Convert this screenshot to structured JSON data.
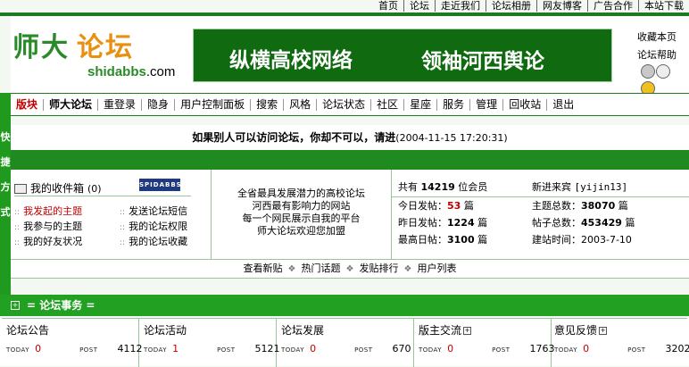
{
  "top_nav": [
    "首页",
    "论坛",
    "走近我们",
    "论坛相册",
    "网友博客",
    "广告合作",
    "本站下载"
  ],
  "logo": {
    "cn_part1": "师大",
    "cn_part2": "论坛",
    "en_main": "shidabbs",
    "en_suffix": ".com"
  },
  "banner": {
    "left": "纵横高校网络",
    "right": "领袖河西舆论"
  },
  "header_links": [
    "收藏本页",
    "论坛帮助"
  ],
  "sidebar_label": "快\n捷\n方\n式",
  "main_nav": [
    "版块",
    "师大论坛",
    "重登录",
    "隐身",
    "用户控制面板",
    "搜索",
    "风格",
    "论坛状态",
    "社区",
    "星座",
    "服务",
    "管理",
    "回收站",
    "退出"
  ],
  "message": {
    "text": "如果别人可以访问论坛，你却不可以，请进",
    "timestamp": "(2004-11-15 17:20:31)"
  },
  "inbox": {
    "label": "我的收件箱",
    "count": "(0)",
    "badge": "SPIDABBS"
  },
  "user_links": [
    [
      "我发起的主题",
      "发送论坛短信"
    ],
    [
      "我参与的主题",
      "我的论坛权限"
    ],
    [
      "我的好友状况",
      "我的论坛收藏"
    ]
  ],
  "slogan": [
    "全省最具发展潜力的高校论坛",
    "河西最有影响力的网站",
    "每一个网民展示自我的平台",
    "师大论坛欢迎您加盟"
  ],
  "stats": {
    "members_prefix": "共有",
    "members_count": "14219",
    "members_suffix": "位会员",
    "newest_label": "新进来宾",
    "newest_name": "[yijin13]",
    "today_label": "今日发帖：",
    "today_value": "53",
    "today_unit": "篇",
    "topics_label": "主题总数：",
    "topics_value": "38070",
    "topics_unit": "篇",
    "yesterday_label": "昨日发帖：",
    "yesterday_value": "1224",
    "yesterday_unit": "篇",
    "posts_label": "帖子总数：",
    "posts_value": "453429",
    "posts_unit": "篇",
    "max_label": "最高日帖：",
    "max_value": "3100",
    "max_unit": "篇",
    "founded_label": "建站时间：",
    "founded_value": "2003-7-10"
  },
  "sub_nav": [
    "查看新贴",
    "热门话题",
    "发贴排行",
    "用户列表"
  ],
  "category": {
    "plus": "+",
    "title": "= 论坛事务 ="
  },
  "forum_labels": {
    "today": "TODAY",
    "post": "POST"
  },
  "forums": [
    {
      "name": "论坛公告",
      "today": "0",
      "post": "4112",
      "plus": ""
    },
    {
      "name": "论坛活动",
      "today": "1",
      "post": "5121",
      "plus": ""
    },
    {
      "name": "论坛发展",
      "today": "0",
      "post": "670",
      "plus": ""
    },
    {
      "name": "版主交流",
      "today": "0",
      "post": "1763",
      "plus": "+"
    },
    {
      "name": "意见反馈",
      "today": "0",
      "post": "3202",
      "plus": "+"
    }
  ]
}
